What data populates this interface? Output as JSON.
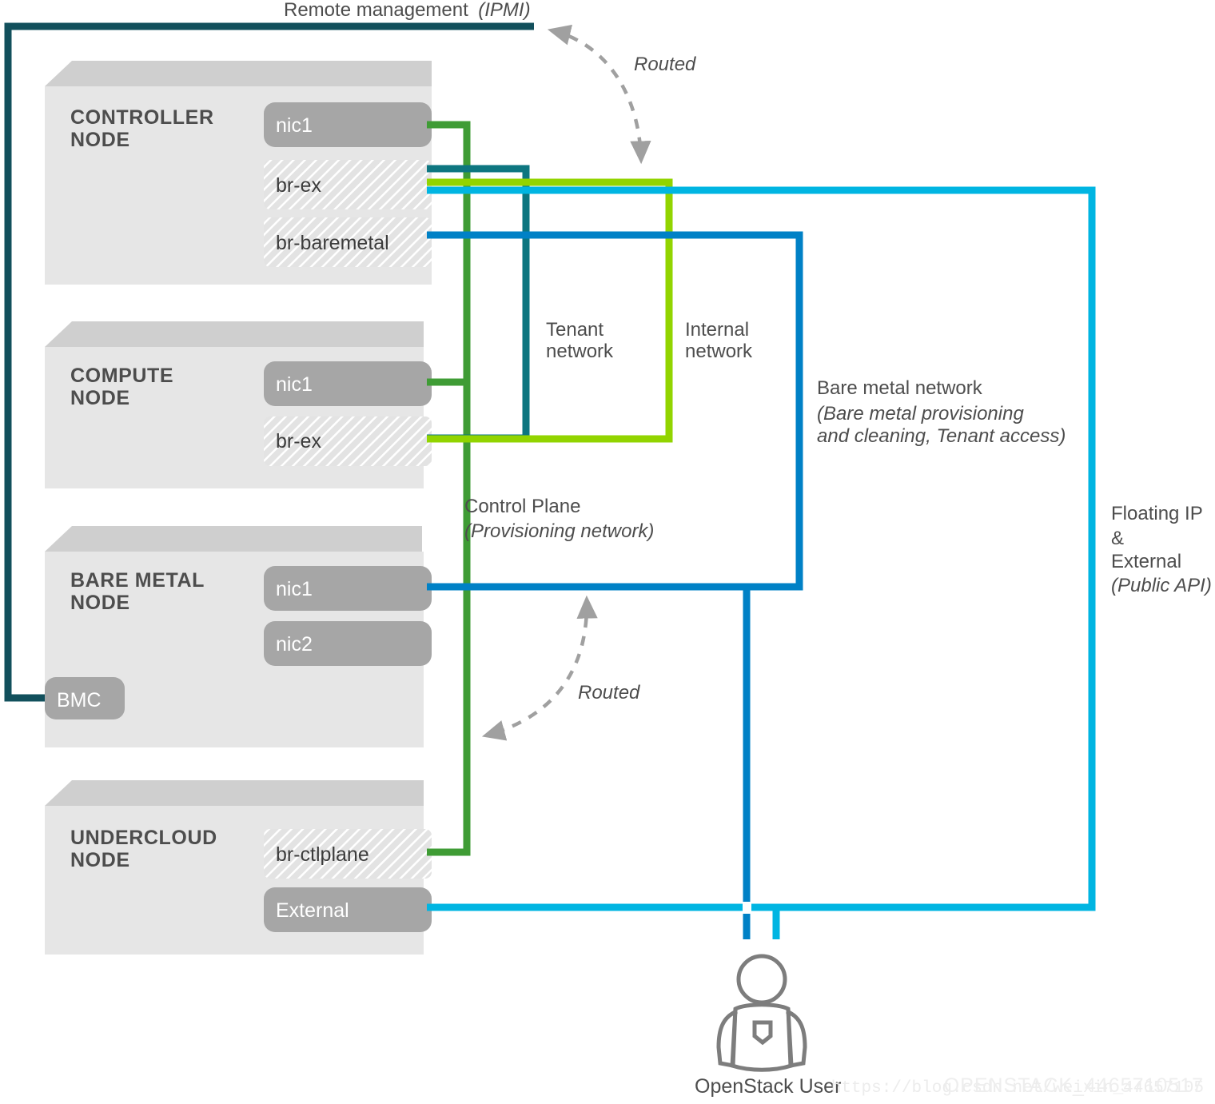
{
  "diagram": {
    "title_note": "Remote management (IPMI)",
    "remote_management": {
      "label": "Remote management",
      "paren": "(IPMI)"
    },
    "nodes": [
      {
        "id": "controller",
        "title_line1": "CONTROLLER",
        "title_line2": "NODE",
        "interfaces": [
          {
            "name": "nic1",
            "style": "solid"
          },
          {
            "name": "br-ex",
            "style": "hatched"
          },
          {
            "name": "br-baremetal",
            "style": "hatched"
          }
        ]
      },
      {
        "id": "compute",
        "title_line1": "COMPUTE",
        "title_line2": "NODE",
        "interfaces": [
          {
            "name": "nic1",
            "style": "solid"
          },
          {
            "name": "br-ex",
            "style": "hatched"
          }
        ]
      },
      {
        "id": "baremetal",
        "title_line1": "BARE METAL",
        "title_line2": "NODE",
        "interfaces": [
          {
            "name": "nic1",
            "style": "solid"
          },
          {
            "name": "nic2",
            "style": "solid"
          },
          {
            "name": "BMC",
            "style": "solid"
          }
        ]
      },
      {
        "id": "undercloud",
        "title_line1": "UNDERCLOUD",
        "title_line2": "NODE",
        "interfaces": [
          {
            "name": "br-ctlplane",
            "style": "hatched"
          },
          {
            "name": "External",
            "style": "solid"
          }
        ]
      }
    ],
    "networks": [
      {
        "id": "tenant",
        "label_line1": "Tenant",
        "label_line2": "network",
        "color": "#0d7680"
      },
      {
        "id": "internal",
        "label_line1": "Internal",
        "label_line2": "network",
        "color": "#92d400"
      },
      {
        "id": "control-plane",
        "label_line1": "Control Plane",
        "label_line2": "(Provisioning network)",
        "color": "#3f9c35"
      },
      {
        "id": "baremetal-network",
        "label_line1": "Bare metal network",
        "label_line2": "(Bare metal provisioning",
        "label_line3": "and cleaning, Tenant access)",
        "color": "#0081c6"
      },
      {
        "id": "floating-external",
        "label_line1": "Floating IP",
        "label_line2": "&",
        "label_line3": "External",
        "label_line4": "(Public API)",
        "color": "#00b5e2"
      },
      {
        "id": "ipmi",
        "label": "Remote management",
        "paren": "(IPMI)",
        "color": "#12505c"
      }
    ],
    "annotations": [
      {
        "id": "routed-top",
        "text": "Routed"
      },
      {
        "id": "routed-bottom",
        "text": "Routed"
      }
    ],
    "actor": {
      "label": "OpenStack User"
    },
    "watermark": {
      "url": "https://blog.csdn.net/weixin_44657105",
      "code": "OPENSTACK_4465710517"
    },
    "colors": {
      "ipmi": "#12505c",
      "tenant": "#0d7680",
      "internal": "#92d400",
      "control_plane": "#3f9c35",
      "baremetal": "#0081c6",
      "external": "#00b5e2",
      "node_face": "#e6e6e6",
      "node_lid": "#cfcfcf",
      "iface_solid": "#a6a6a6",
      "iface_hatch": "#dedede",
      "text": "#4d4d4d",
      "dashed": "#a0a0a0"
    }
  }
}
